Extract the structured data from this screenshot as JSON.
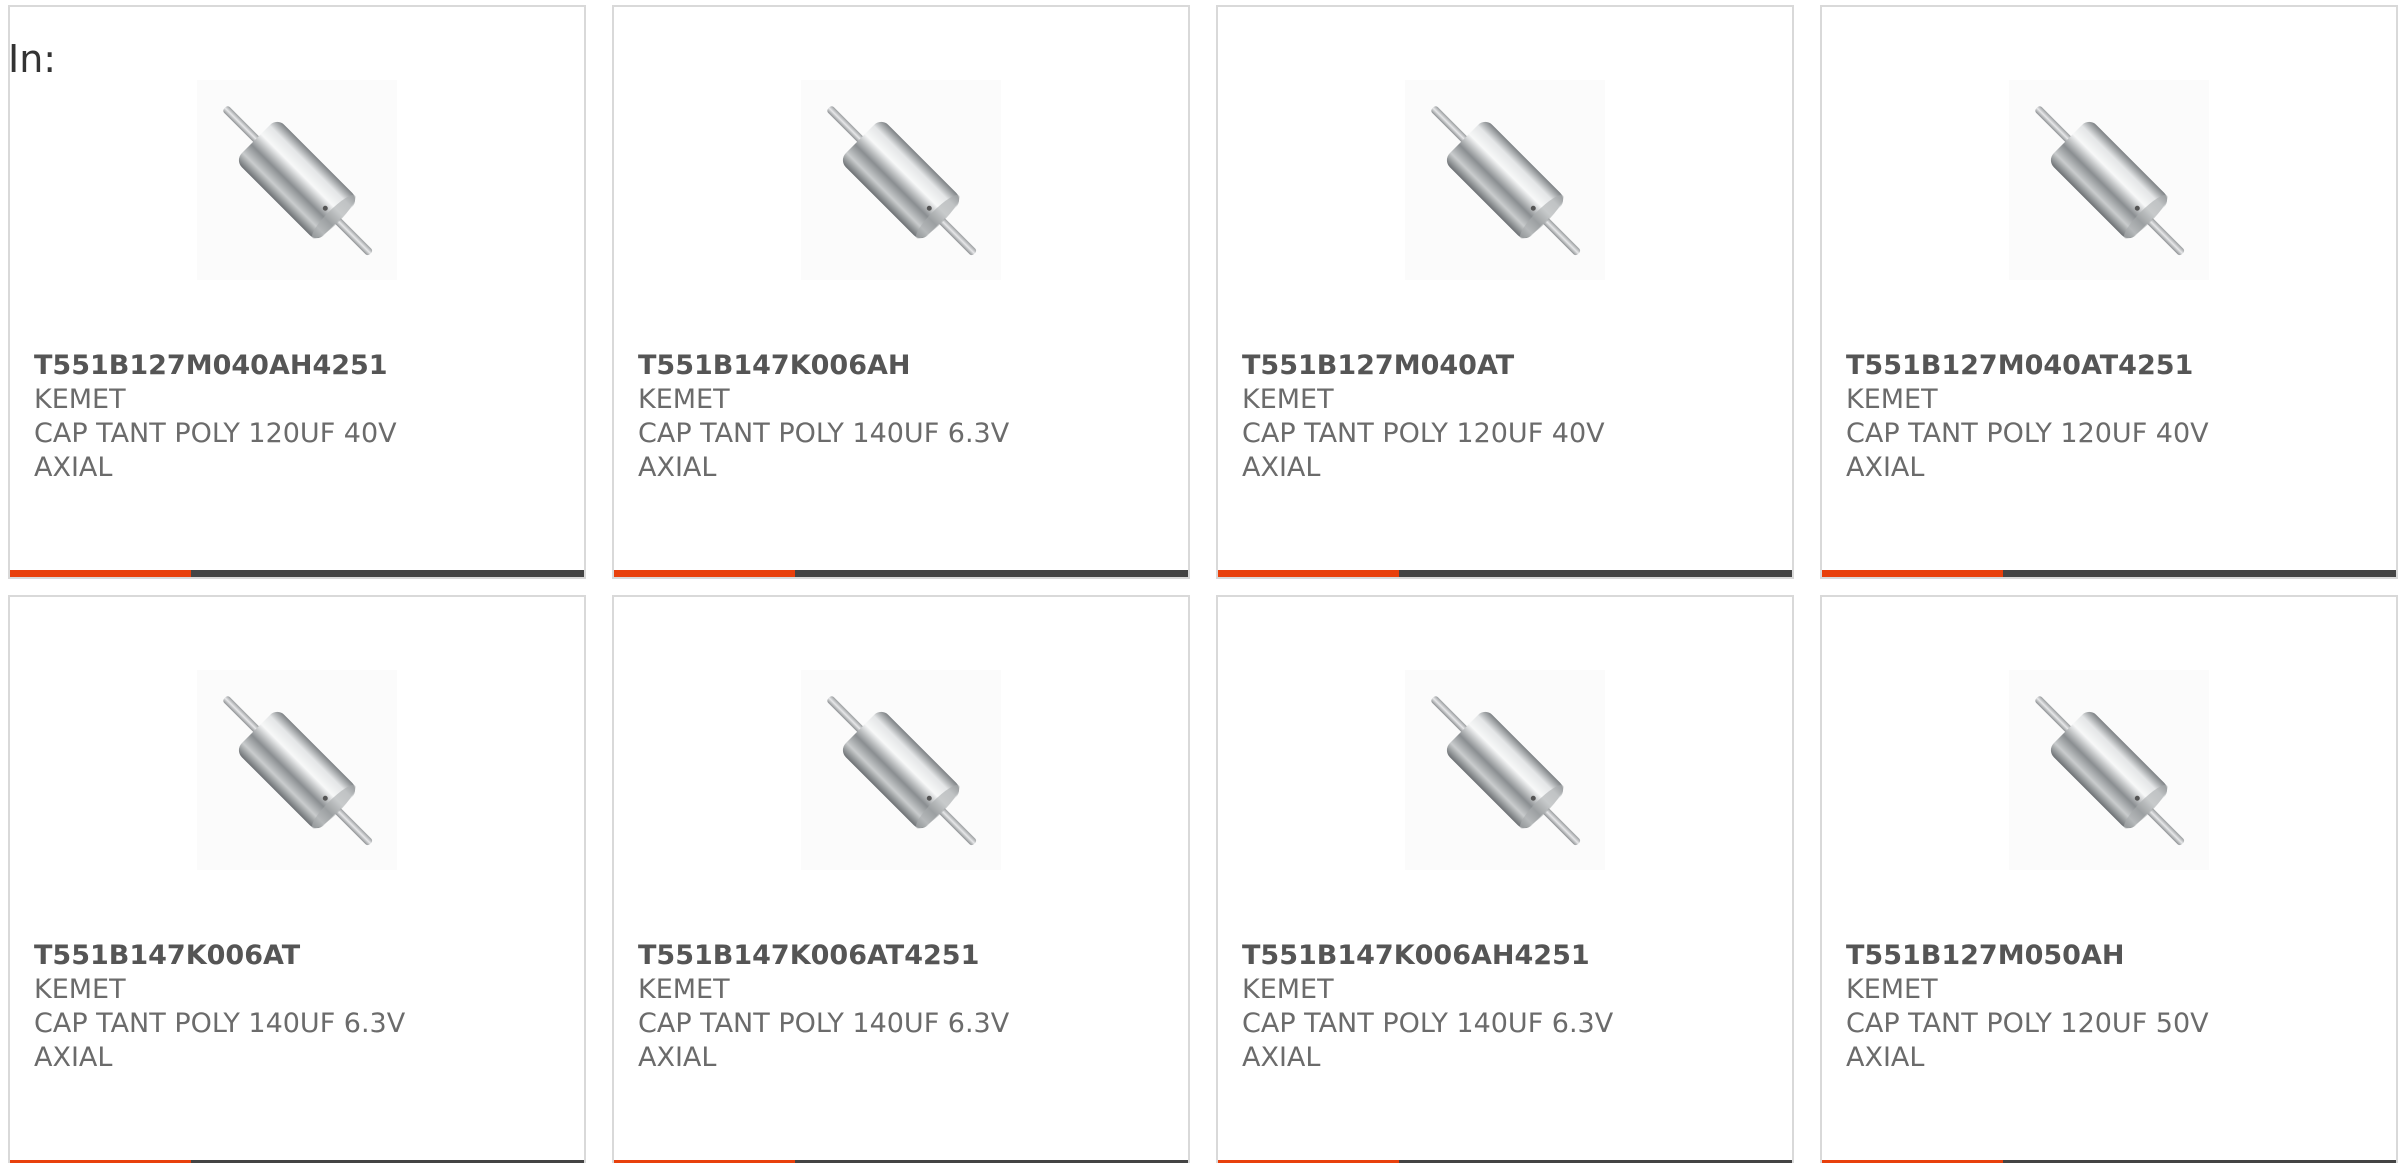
{
  "filter_label": "In:",
  "colors": {
    "accent": "#e8400c",
    "bar": "#444444",
    "border": "#d9d9d9"
  },
  "products": [
    {
      "part_number": "T551B127M040AH4251",
      "manufacturer": "KEMET",
      "description": "CAP TANT POLY 120UF 40V AXIAL",
      "image_icon": "axial-capacitor-icon"
    },
    {
      "part_number": "T551B147K006AH",
      "manufacturer": "KEMET",
      "description": "CAP TANT POLY 140UF 6.3V AXIAL",
      "image_icon": "axial-capacitor-icon"
    },
    {
      "part_number": "T551B127M040AT",
      "manufacturer": "KEMET",
      "description": "CAP TANT POLY 120UF 40V AXIAL",
      "image_icon": "axial-capacitor-icon"
    },
    {
      "part_number": "T551B127M040AT4251",
      "manufacturer": "KEMET",
      "description": "CAP TANT POLY 120UF 40V AXIAL",
      "image_icon": "axial-capacitor-icon"
    },
    {
      "part_number": "T551B147K006AT",
      "manufacturer": "KEMET",
      "description": "CAP TANT POLY 140UF 6.3V AXIAL",
      "image_icon": "axial-capacitor-icon"
    },
    {
      "part_number": "T551B147K006AT4251",
      "manufacturer": "KEMET",
      "description": "CAP TANT POLY 140UF 6.3V AXIAL",
      "image_icon": "axial-capacitor-icon"
    },
    {
      "part_number": "T551B147K006AH4251",
      "manufacturer": "KEMET",
      "description": "CAP TANT POLY 140UF 6.3V AXIAL",
      "image_icon": "axial-capacitor-icon"
    },
    {
      "part_number": "T551B127M050AH",
      "manufacturer": "KEMET",
      "description": "CAP TANT POLY 120UF 50V AXIAL",
      "image_icon": "axial-capacitor-icon"
    }
  ]
}
